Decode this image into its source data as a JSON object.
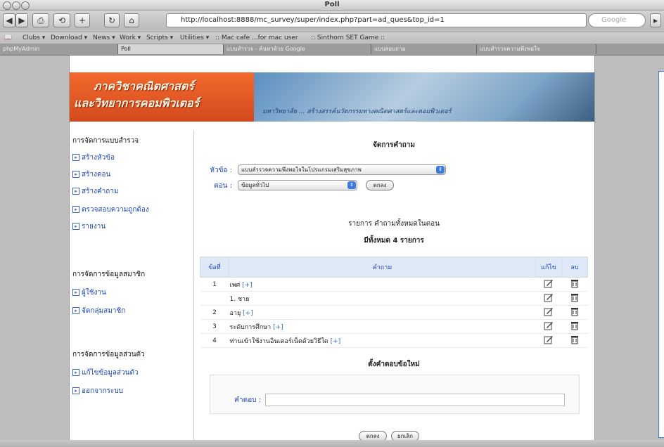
{
  "window": {
    "title": "Poll"
  },
  "toolbar": {
    "url": "http://localhost:8888/mc_survey/super/index.php?part=ad_ques&top_id=1",
    "search_placeholder": "Google"
  },
  "bookmarks": [
    "Clubs ▾",
    "Download ▾",
    "News ▾",
    "Work ▾",
    "Scripts ▾",
    "Utilities ▾",
    ":: Mac cafe ...for mac user",
    ":: Sinthorn SET Game ::"
  ],
  "tabs": [
    "phpMyAdmin",
    "Poll",
    "แบบสำรวจ - ค้นหาด้วย Google",
    "แบบสอบถาม",
    "แบบสำรวจความพึงพอใจ"
  ],
  "banner": {
    "line1": "ภาควิชาคณิตศาสตร์",
    "line2": "และวิทยาการคอมพิวเตอร์",
    "subtitle": "มหาวิทยาลัย ... สร้างสรรค์นวัตกรรมทางคณิตศาสตร์และคอมพิวเตอร์"
  },
  "sidebar": {
    "sections": [
      {
        "title": "การจัดการแบบสำรวจ",
        "items": [
          "สร้างหัวข้อ",
          "สร้างตอน",
          "สร้างคำถาม",
          "ตรวจสอบความถูกต้อง",
          "รายงาน"
        ]
      },
      {
        "title": "การจัดการข้อมูลสมาชิก",
        "items": [
          "ผู้ใช้งาน",
          "จัดกลุ่มสมาชิก"
        ]
      },
      {
        "title": "การจัดการข้อมูลส่วนตัว",
        "items": [
          "แก้ไขข้อมูลส่วนตัว",
          "ออกจากระบบ"
        ]
      }
    ]
  },
  "main": {
    "heading": "จัดการคำถาม",
    "topic_label": "หัวข้อ :",
    "topic_value": "แบบสำรวจความพึงพอใจในโปรแกรมเสริมสุขภาพ",
    "part_label": "ตอน :",
    "part_value": "ข้อมูลทั่วไป",
    "go_button": "ตกลง",
    "list_title": "รายการ คำถามทั้งหมดในตอน",
    "list_count": "มีทั้งหมด 4 รายการ",
    "table": {
      "headers": [
        "ข้อที่",
        "คำถาม",
        "แก้ไข",
        "ลบ"
      ],
      "rows": [
        {
          "num": "1",
          "text": "เพศ",
          "plus": "[+]"
        },
        {
          "num": "",
          "text": "1. ชาย",
          "plus": ""
        },
        {
          "num": "2",
          "text": "อายุ",
          "plus": "[+]"
        },
        {
          "num": "3",
          "text": "ระดับการศึกษา",
          "plus": "[+]"
        },
        {
          "num": "4",
          "text": "ท่านเข้าใช้งานอินเตอร์เน็ตด้วยวิธีใด",
          "plus": "[+]"
        }
      ]
    },
    "new_answer_title": "ตั้งคำตอบข้อใหม่",
    "answer_label": "คำตอบ :",
    "save_button": "ตกลง",
    "cancel_button": "ยกเลิก"
  }
}
